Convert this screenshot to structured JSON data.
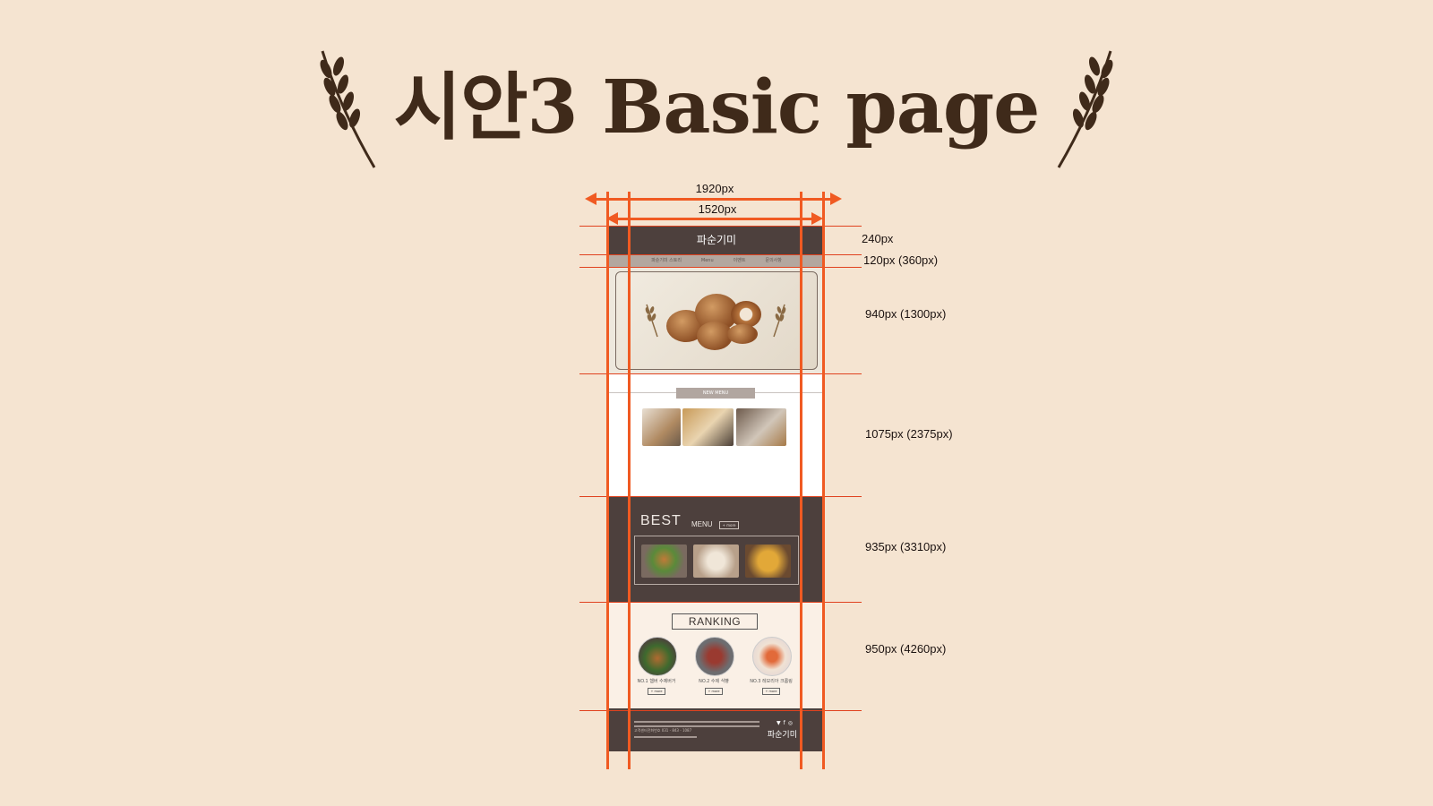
{
  "title": "시안3  Basic page",
  "widths": {
    "outer": "1920px",
    "inner": "1520px"
  },
  "sections": [
    {
      "label": "240px"
    },
    {
      "label": "120px (360px)"
    },
    {
      "label": "940px (1300px)"
    },
    {
      "label": "1075px (2375px)"
    },
    {
      "label": "935px (3310px)"
    },
    {
      "label": "950px (4260px)"
    }
  ],
  "mockup": {
    "logo": "파순기미",
    "nav": [
      "파순기미 스토리",
      "Menu",
      "이벤트",
      "문의사항"
    ],
    "new_menu": "NEW MENU",
    "best_title": "BEST",
    "best_sub": "MENU",
    "best_more": "+ more",
    "ranking_title": "RANKING",
    "ranking_items": [
      {
        "label": "NO.1 햄버 수제버거",
        "btn": "+ more"
      },
      {
        "label": "NO.2 수제 식빵",
        "btn": "+ more"
      },
      {
        "label": "NO.3 레모리아 크롬링",
        "btn": "+ more"
      }
    ],
    "footer_logo": "파순기미",
    "footer_phone": "고객센터전화번호 031 - 843 - 1087"
  },
  "colors": {
    "background": "#f5e4d1",
    "annotation": "#f05a22",
    "dark_section": "#4d403d"
  }
}
